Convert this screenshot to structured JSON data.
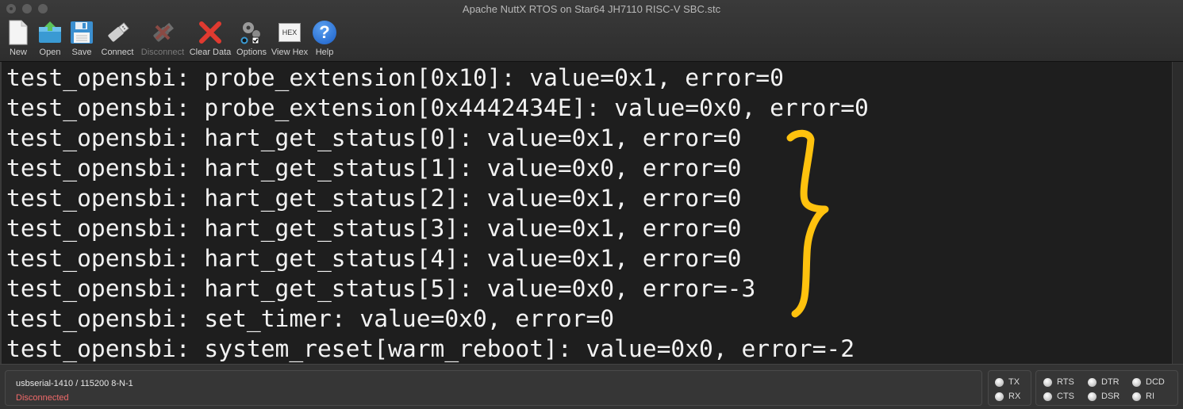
{
  "window": {
    "title": "Apache NuttX RTOS on Star64 JH7110 RISC-V SBC.stc"
  },
  "toolbar": {
    "items": [
      {
        "id": "new",
        "label": "New",
        "icon": "document-icon",
        "enabled": true
      },
      {
        "id": "open",
        "label": "Open",
        "icon": "folder-open-icon",
        "enabled": true
      },
      {
        "id": "save",
        "label": "Save",
        "icon": "floppy-disk-icon",
        "enabled": true
      },
      {
        "id": "connect",
        "label": "Connect",
        "icon": "usb-plug-icon",
        "enabled": true
      },
      {
        "id": "disconnect",
        "label": "Disconnect",
        "icon": "usb-unplug-icon",
        "enabled": false
      },
      {
        "id": "clear",
        "label": "Clear Data",
        "icon": "red-x-icon",
        "enabled": true
      },
      {
        "id": "options",
        "label": "Options",
        "icon": "gears-icon",
        "enabled": true
      },
      {
        "id": "hex",
        "label": "View Hex",
        "icon": "hex-icon",
        "icon_text": "HEX",
        "enabled": true
      },
      {
        "id": "help",
        "label": "Help",
        "icon": "question-icon",
        "icon_text": "?",
        "enabled": true
      }
    ]
  },
  "terminal": {
    "lines": [
      "test_opensbi: probe_extension[0x10]: value=0x1, error=0",
      "test_opensbi: probe_extension[0x4442434E]: value=0x0, error=0",
      "test_opensbi: hart_get_status[0]: value=0x1, error=0",
      "test_opensbi: hart_get_status[1]: value=0x0, error=0",
      "test_opensbi: hart_get_status[2]: value=0x1, error=0",
      "test_opensbi: hart_get_status[3]: value=0x1, error=0",
      "test_opensbi: hart_get_status[4]: value=0x1, error=0",
      "test_opensbi: hart_get_status[5]: value=0x0, error=-3",
      "test_opensbi: set_timer: value=0x0, error=0",
      "test_opensbi: system_reset[warm_reboot]: value=0x0, error=-2"
    ],
    "annotation_color": "#ffc20e"
  },
  "status": {
    "connection": "usbserial-1410 / 115200 8-N-1",
    "state": "Disconnected",
    "state_color": "#f06a6a",
    "indicators": {
      "tx": "TX",
      "rx": "RX",
      "rts": "RTS",
      "cts": "CTS",
      "dtr": "DTR",
      "dsr": "DSR",
      "dcd": "DCD",
      "ri": "RI"
    }
  }
}
